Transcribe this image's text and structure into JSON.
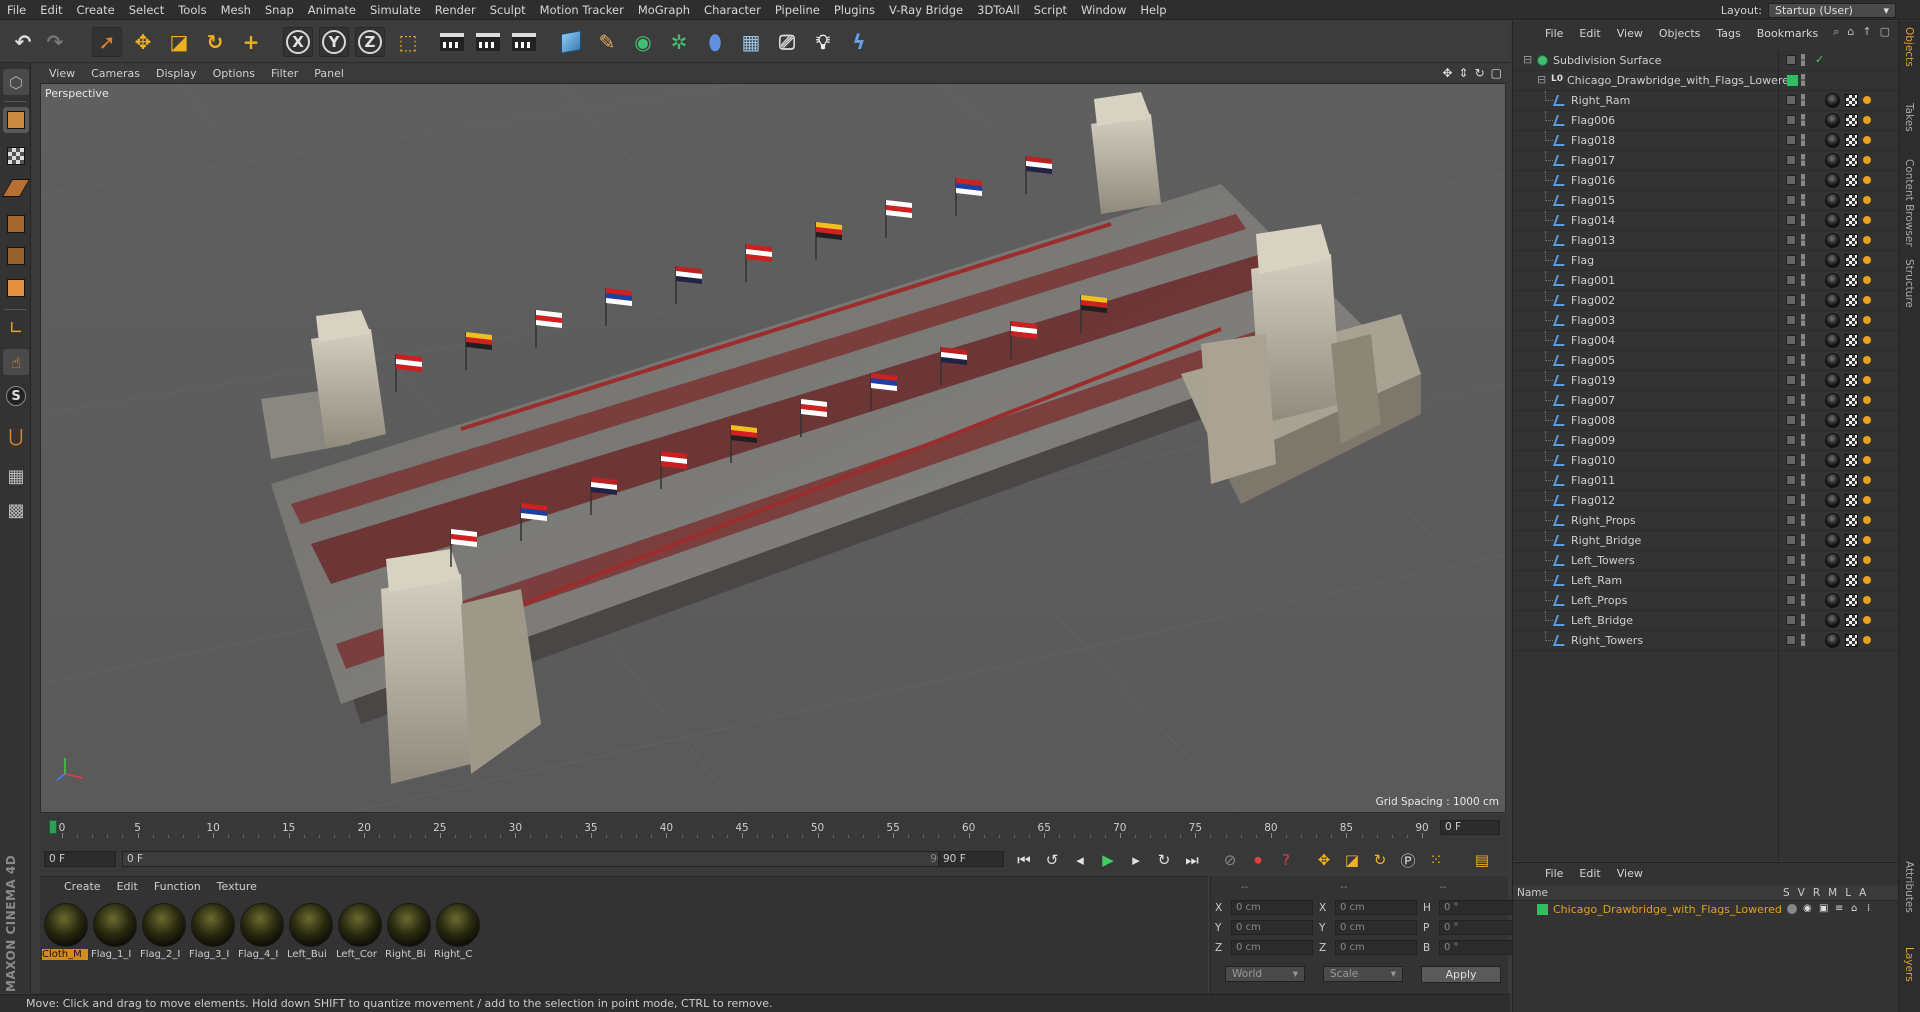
{
  "menubar": {
    "items": [
      "File",
      "Edit",
      "Create",
      "Select",
      "Tools",
      "Mesh",
      "Snap",
      "Animate",
      "Simulate",
      "Render",
      "Sculpt",
      "Motion Tracker",
      "MoGraph",
      "Character",
      "Pipeline",
      "Plugins",
      "V-Ray Bridge",
      "3DToAll",
      "Script",
      "Window",
      "Help"
    ],
    "layout_label": "Layout:",
    "layout_value": "Startup (User)"
  },
  "toolbar": {
    "icons": [
      "undo-icon",
      "redo-icon",
      "live-select-icon",
      "move-icon",
      "scale-icon",
      "rotate-icon",
      "create-object-icon",
      "x-axis-icon",
      "y-axis-icon",
      "z-axis-icon",
      "coordinate-system-icon",
      "render-view-icon",
      "render-picture-viewer-icon",
      "edit-render-settings-icon",
      "cube-icon",
      "pen-icon",
      "subdivision-surface-icon",
      "array-icon",
      "deformer-icon",
      "floor-icon",
      "camera-icon",
      "light-icon",
      "python-icon"
    ],
    "axis_x": "X",
    "axis_y": "Y",
    "axis_z": "Z"
  },
  "viewport": {
    "menu": [
      "View",
      "Cameras",
      "Display",
      "Options",
      "Filter",
      "Panel"
    ],
    "label": "Perspective",
    "grid_spacing": "Grid Spacing : 1000 cm",
    "colors": {
      "bg": "#5c5c5c",
      "road": "#7a7a78",
      "stone": "#b8b2a2",
      "rail": "#8b2a2a"
    }
  },
  "timeline": {
    "ticks": [
      0,
      5,
      10,
      15,
      20,
      25,
      30,
      35,
      40,
      45,
      50,
      55,
      60,
      65,
      70,
      75,
      80,
      85,
      90
    ],
    "end_field": "0 F",
    "current_frame": "0 F",
    "range_start": "0 F",
    "range_end": "90 F",
    "max_field": "90 F"
  },
  "materials": {
    "menu": [
      "Create",
      "Edit",
      "Function",
      "Texture"
    ],
    "items": [
      "Cloth_M",
      "Flag_1_I",
      "Flag_2_I",
      "Flag_3_I",
      "Flag_4_I",
      "Left_Bui",
      "Left_Cor",
      "Right_Bi",
      "Right_C"
    ]
  },
  "coords": {
    "header": [
      "--",
      "--",
      "--"
    ],
    "rows": [
      {
        "a": "X",
        "av": "0 cm",
        "b": "X",
        "bv": "0 cm",
        "c": "H",
        "cv": "0 °"
      },
      {
        "a": "Y",
        "av": "0 cm",
        "b": "Y",
        "bv": "0 cm",
        "c": "P",
        "cv": "0 °"
      },
      {
        "a": "Z",
        "av": "0 cm",
        "b": "Z",
        "bv": "0 cm",
        "c": "B",
        "cv": "0 °"
      }
    ],
    "world": "World",
    "scale": "Scale",
    "apply": "Apply"
  },
  "status": "Move: Click and drag to move elements. Hold down SHIFT to quantize movement / add to the selection in point mode, CTRL to remove.",
  "object_manager": {
    "menu": [
      "File",
      "Edit",
      "View",
      "Objects",
      "Tags",
      "Bookmarks"
    ],
    "root": "Subdivision Surface",
    "group": "Chicago_Drawbridge_with_Flags_Lowered",
    "children": [
      "Right_Ram",
      "Flag006",
      "Flag018",
      "Flag017",
      "Flag016",
      "Flag015",
      "Flag014",
      "Flag013",
      "Flag",
      "Flag001",
      "Flag002",
      "Flag003",
      "Flag004",
      "Flag005",
      "Flag019",
      "Flag007",
      "Flag008",
      "Flag009",
      "Flag010",
      "Flag011",
      "Flag012",
      "Right_Props",
      "Right_Bridge",
      "Left_Towers",
      "Left_Ram",
      "Left_Props",
      "Left_Bridge",
      "Right_Towers"
    ]
  },
  "layer_manager": {
    "menu": [
      "File",
      "Edit",
      "View"
    ],
    "col_name": "Name",
    "cols": [
      "S",
      "V",
      "R",
      "M",
      "L",
      "A"
    ],
    "layer": "Chicago_Drawbridge_with_Flags_Lowered"
  },
  "vtabs": [
    "Objects",
    "Takes",
    "Content Browser",
    "Structure",
    "Attributes",
    "Layers"
  ]
}
